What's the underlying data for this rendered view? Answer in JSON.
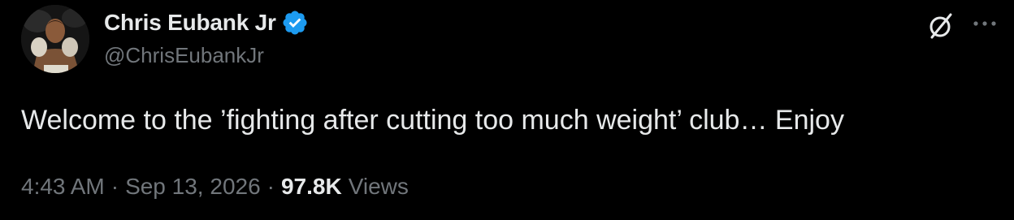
{
  "author": {
    "display_name": "Chris Eubank Jr",
    "handle": "@ChrisEubankJr",
    "verified": true,
    "verified_color": "#1d9bf0"
  },
  "icons": {
    "verified": "verified-badge-icon",
    "grok": "grok-slash-icon",
    "more": "more-ellipsis-icon",
    "avatar": "profile-photo"
  },
  "tweet": {
    "text": "Welcome to the ’fighting after cutting too much weight’ club… Enjoy"
  },
  "meta": {
    "time": "4:43 AM",
    "date": "Sep 13, 2026",
    "separator": "·",
    "views_count": "97.8K",
    "views_label": "Views"
  },
  "colors": {
    "background": "#000000",
    "primary_text": "#e7e9ea",
    "secondary_text": "#71767b"
  }
}
